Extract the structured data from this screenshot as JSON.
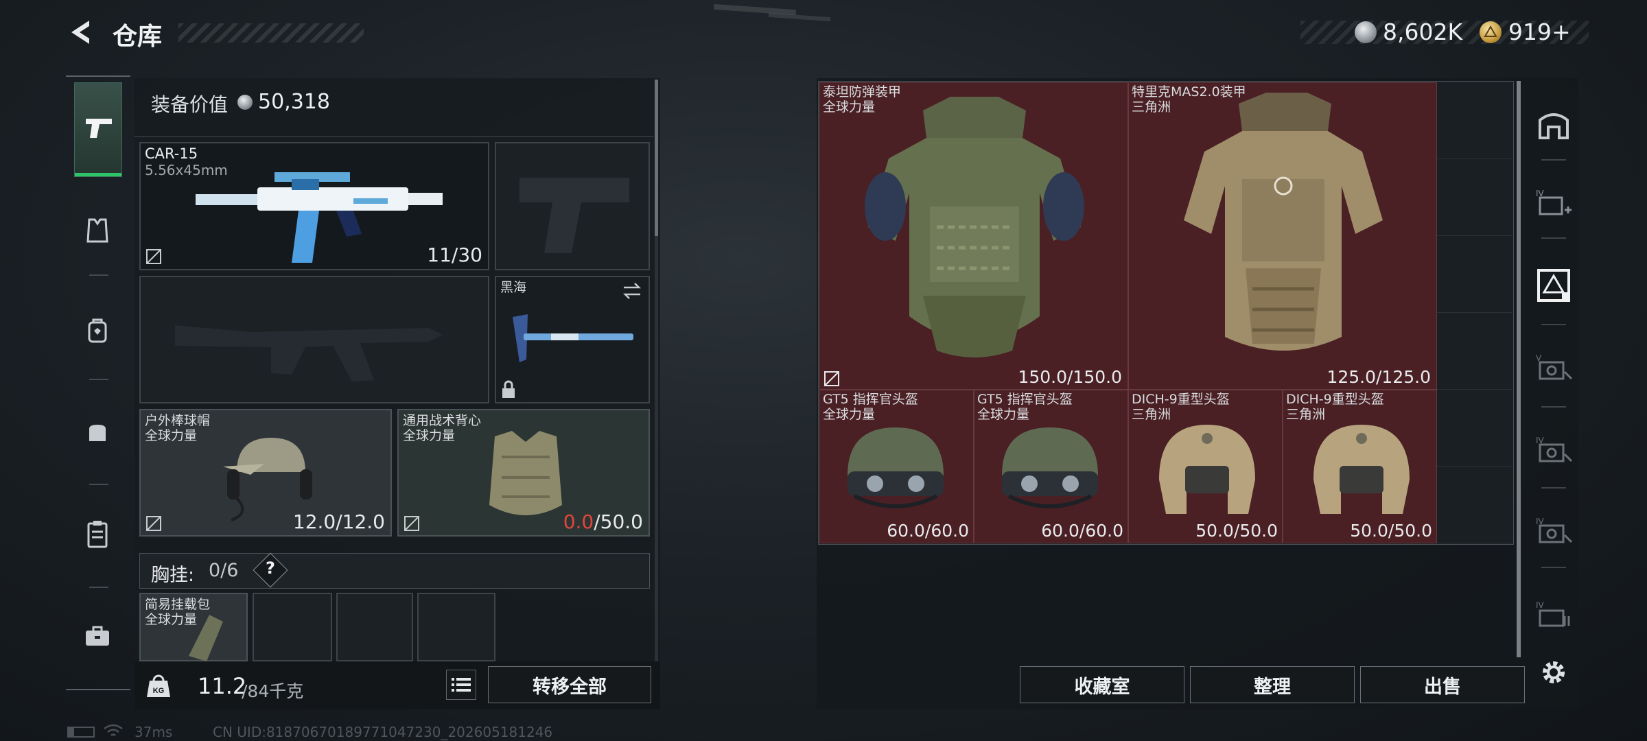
{
  "header": {
    "title": "仓库",
    "currency1": "8,602K",
    "currency2": "919+"
  },
  "equipment": {
    "value_label": "装备价值",
    "value": "50,318",
    "primary": {
      "name": "CAR-15",
      "caliber": "5.56x45mm",
      "ammo": "11/30"
    },
    "melee": {
      "name": "黑海"
    },
    "helmet": {
      "name": "户外棒球帽",
      "region": "全球力量",
      "durability": "12.0/12.0"
    },
    "armor": {
      "name": "通用战术背心",
      "region": "全球力量",
      "durability_current": "0.0",
      "durability_max": "/50.0"
    },
    "rig": {
      "label": "胸挂:",
      "count": "0/6",
      "help": "?"
    },
    "rig_item": {
      "name": "简易挂载包",
      "region": "全球力量"
    },
    "weight": {
      "current": "11.2",
      "max": "/84千克"
    },
    "transfer_all": "转移全部"
  },
  "storage": {
    "items": [
      {
        "name": "泰坦防弹装甲",
        "region": "全球力量",
        "durability": "150.0/150.0"
      },
      {
        "name": "特里克MAS2.0装甲",
        "region": "三角洲",
        "durability": "125.0/125.0"
      },
      {
        "name": "GT5 指挥官头盔",
        "region": "全球力量",
        "durability": "60.0/60.0"
      },
      {
        "name": "GT5 指挥官头盔",
        "region": "全球力量",
        "durability": "60.0/60.0"
      },
      {
        "name": "DICH-9重型头盔",
        "region": "三角洲",
        "durability": "50.0/50.0"
      },
      {
        "name": "DICH-9重型头盔",
        "region": "三角洲",
        "durability": "50.0/50.0"
      }
    ],
    "buttons": {
      "collection": "收藏室",
      "organize": "整理",
      "sell": "出售"
    }
  },
  "status": {
    "ping": "37ms",
    "uid": "CN UID:818706701897710472​30_202605181246"
  },
  "colors": {
    "accent": "#2ec46a",
    "storage_bg": "#4a2024",
    "damage": "#e0463c"
  }
}
